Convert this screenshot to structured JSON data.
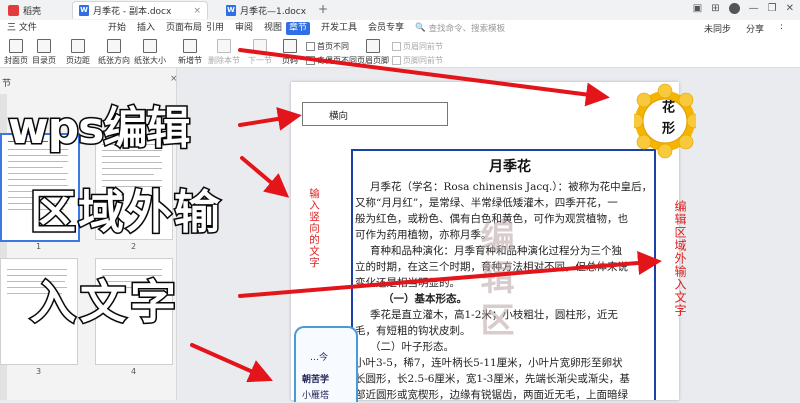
{
  "titlebar": {
    "tabs": [
      {
        "label": "稻壳",
        "active": false
      },
      {
        "label": "月季花 - 副本.docx",
        "active": true
      },
      {
        "label": "月季花—1.docx",
        "active": false
      }
    ],
    "add_tab": "+"
  },
  "menu": {
    "file": "三 文件",
    "items": [
      "开始",
      "插入",
      "页面布局",
      "引用",
      "审阅",
      "视图",
      "章节",
      "开发工具",
      "会员专享"
    ],
    "active": "章节",
    "search_placeholder": "查找命令、搜索模板",
    "sync": "未同步",
    "share": "分享",
    "more": ":"
  },
  "ribbon": {
    "buttons": [
      {
        "label": "封面页"
      },
      {
        "label": "目录页"
      },
      {
        "label": "页边距"
      },
      {
        "label": "纸张方向"
      },
      {
        "label": "纸张大小"
      },
      {
        "label": "新增节"
      },
      {
        "label": "删除本节",
        "disabled": true
      },
      {
        "label": "下一节",
        "disabled": true
      },
      {
        "label": "页码"
      },
      {
        "label": "页眉页脚"
      }
    ],
    "checks": [
      {
        "label": "首页不同"
      },
      {
        "label": "奇偶页不同"
      },
      {
        "label": "页眉同前节",
        "disabled": true
      },
      {
        "label": "页脚同前节",
        "disabled": true
      }
    ]
  },
  "panel": {
    "title": "节",
    "close": "×",
    "page_numbers": [
      "1",
      "2",
      "3",
      "4"
    ]
  },
  "document": {
    "header_box": "横向",
    "title": "月季花",
    "paragraphs": [
      "月季花（学名：Rosa chinensis Jacq.）：被称为花中皇后，",
      "又称“月月红”，是常绿、半常绿低矮灌木，四季开花，一",
      "般为红色，或粉色、偶有白色和黄色，可作为观赏植物，也",
      "可作为药用植物，亦称月季。",
      "育种和品种演化：月季育种和品种演化过程分为三个独",
      "立的时期，在这三个时期，育种方法相对不同，但总体来说",
      "变化还是相当明显的。",
      "（一）基本形态。",
      "季花是直立灌木，高1-2米；小枝粗壮，圆柱形，近无",
      "毛，有短粗的钩状皮刺。",
      "（二）叶子形态。",
      "小叶3-5，稀7，连叶柄长5-11厘米，小叶片宽卵形至卵状",
      "长圆形，长2.5-6厘米，宽1-3厘米，先端长渐尖或渐尖，基",
      "部近圆形或宽楔形，边缘有锐锯齿，两面近无毛，上面暗绿"
    ],
    "left_vertical": "输入竖向的文字",
    "right_vertical": "编辑区域外输入文字",
    "watermark": "编辑区",
    "flower_label": "花形",
    "bubble_lines": [
      "…今",
      "朝苦学",
      "小雁塔"
    ]
  },
  "annotation": {
    "lines": [
      "wps编辑",
      "区域外输",
      "入文字"
    ],
    "arrow_color": "#e4141b"
  },
  "colors": {
    "accent": "#2f6fe3",
    "doc_border": "#1e3fa8",
    "red_text": "#d22222",
    "flower": "#f4b400"
  }
}
